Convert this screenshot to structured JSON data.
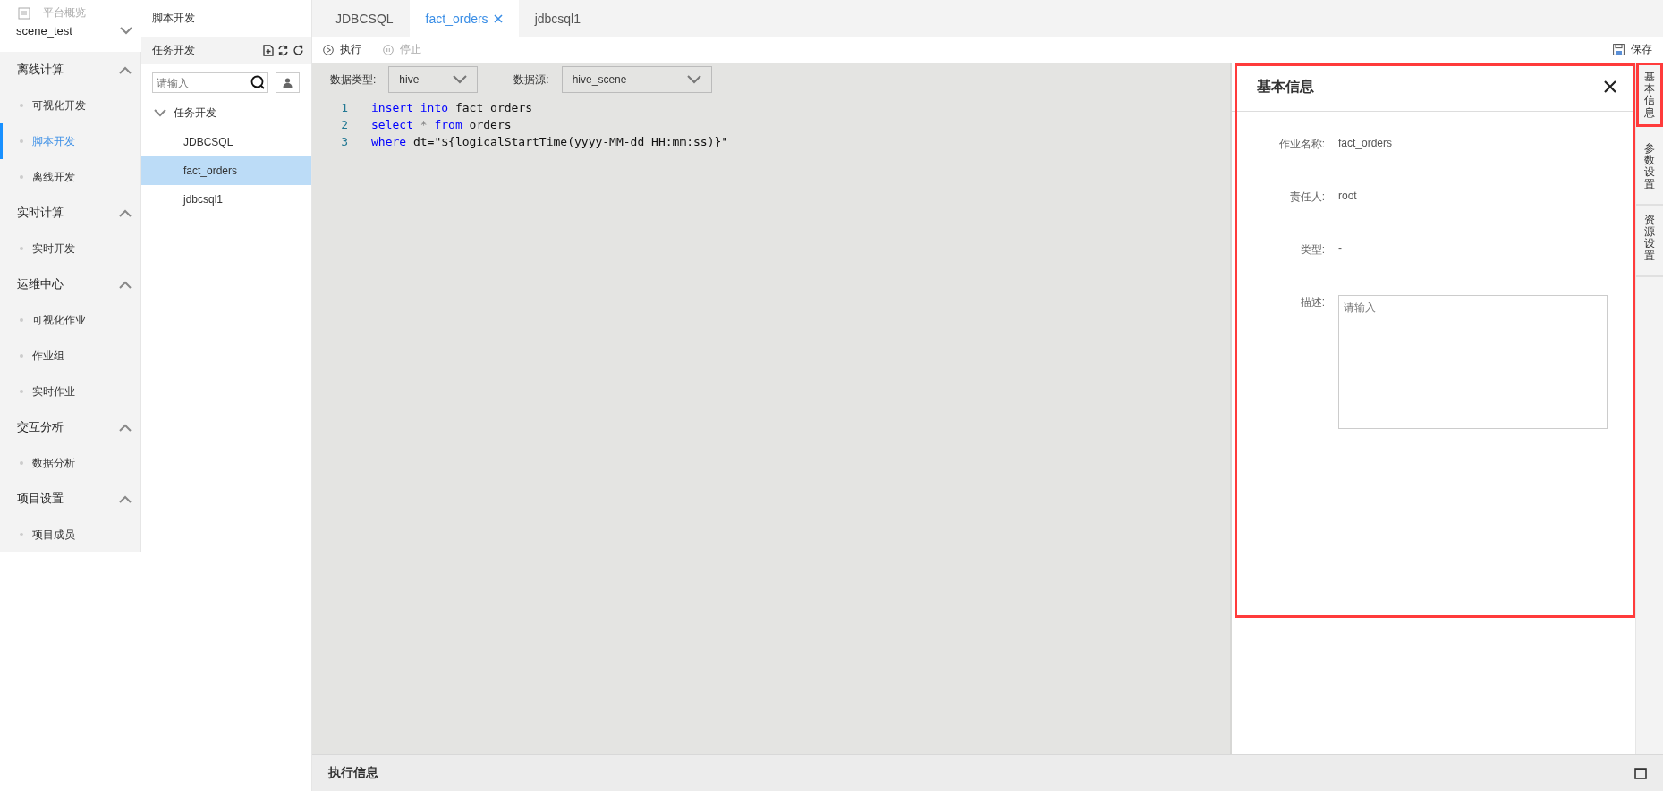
{
  "nav": {
    "overview": "平台概览",
    "project": "scene_test",
    "groups": [
      {
        "title": "离线计算",
        "expanded": true,
        "items": [
          {
            "label": "可视化开发",
            "selected": false
          },
          {
            "label": "脚本开发",
            "selected": true
          },
          {
            "label": "离线开发",
            "selected": false
          }
        ]
      },
      {
        "title": "实时计算",
        "expanded": true,
        "items": [
          {
            "label": "实时开发",
            "selected": false
          }
        ]
      },
      {
        "title": "运维中心",
        "expanded": true,
        "items": [
          {
            "label": "可视化作业",
            "selected": false
          },
          {
            "label": "作业组",
            "selected": false
          },
          {
            "label": "实时作业",
            "selected": false
          }
        ]
      },
      {
        "title": "交互分析",
        "expanded": true,
        "items": [
          {
            "label": "数据分析",
            "selected": false
          }
        ]
      },
      {
        "title": "项目设置",
        "expanded": true,
        "items": [
          {
            "label": "项目成员",
            "selected": false
          }
        ]
      }
    ]
  },
  "tree_panel": {
    "title": "脚本开发",
    "section": "任务开发",
    "search": {
      "placeholder": "请输入"
    },
    "root": {
      "label": "任务开发",
      "expanded": true,
      "children": [
        {
          "label": "JDBCSQL",
          "selected": false
        },
        {
          "label": "fact_orders",
          "selected": true
        },
        {
          "label": "jdbcsql1",
          "selected": false
        }
      ]
    }
  },
  "tabs": [
    {
      "label": "JDBCSQL",
      "selected": false
    },
    {
      "label": "fact_orders",
      "selected": true,
      "closable": true
    },
    {
      "label": "jdbcsql1",
      "selected": false
    }
  ],
  "toolbar": {
    "run": {
      "label": "执行",
      "disabled": false
    },
    "stop": {
      "label": "停止",
      "disabled": true
    },
    "save": "保存"
  },
  "selects": [
    {
      "label": "数据类型:",
      "value": "hive"
    },
    {
      "label": "数据源:",
      "value": "hive_scene"
    }
  ],
  "code": [
    {
      "number": "1",
      "tokens": [
        {
          "text": "insert ",
          "kind": "keyword"
        },
        {
          "text": "into",
          "kind": "keyword"
        },
        {
          "text": " fact_orders",
          "kind": "plain"
        }
      ]
    },
    {
      "number": "2",
      "tokens": [
        {
          "text": "select",
          "kind": "keyword"
        },
        {
          "text": " * ",
          "kind": "operator"
        },
        {
          "text": "from",
          "kind": "keyword"
        },
        {
          "text": " orders",
          "kind": "plain"
        }
      ]
    },
    {
      "number": "3",
      "tokens": [
        {
          "text": "where",
          "kind": "keyword"
        },
        {
          "text": " dt=\"${logicalStartTime(yyyy-MM-dd HH:mm:ss)}\"",
          "kind": "plain"
        }
      ]
    }
  ],
  "info_panel": {
    "title": "基本信息",
    "highlighted": true,
    "fields": [
      {
        "label": "作业名称:",
        "value": "fact_orders"
      },
      {
        "label": "责任人:",
        "value": "root"
      },
      {
        "label": "类型:",
        "value": "-"
      }
    ],
    "description": {
      "label": "描述:",
      "placeholder": "请输入"
    }
  },
  "side_tabs": [
    {
      "label": "基本信息",
      "selected": true
    },
    {
      "label": "参数设置",
      "selected": false
    },
    {
      "label": "资源设置",
      "selected": false
    }
  ],
  "bottom_bar": {
    "title": "执行信息"
  }
}
